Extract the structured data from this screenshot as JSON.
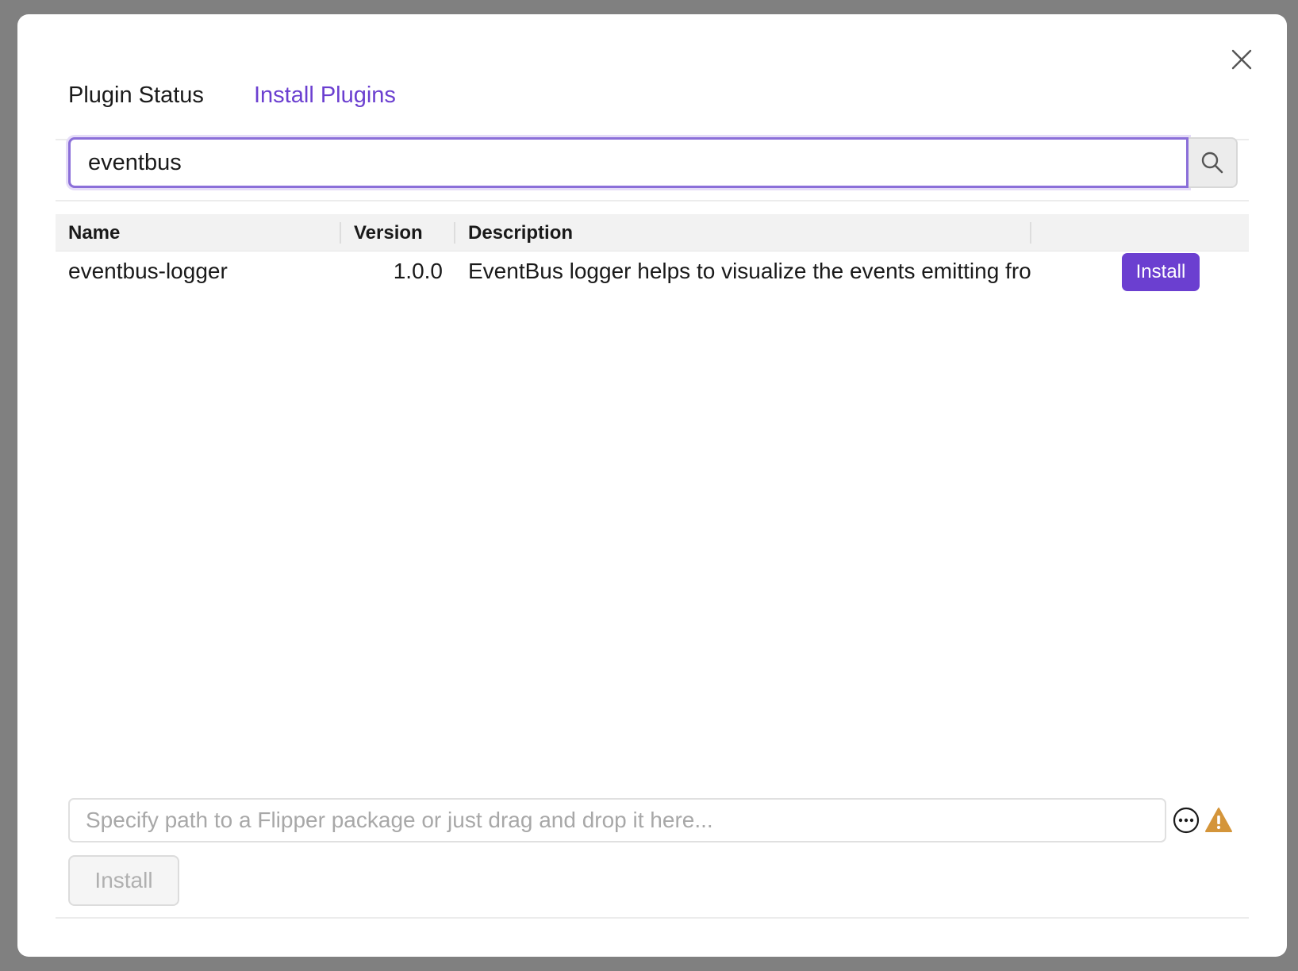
{
  "tabs": [
    {
      "label": "Plugin Status",
      "active": false
    },
    {
      "label": "Install Plugins",
      "active": true
    }
  ],
  "search": {
    "value": "eventbus",
    "icon": "search-icon"
  },
  "table": {
    "columns": [
      "Name",
      "Version",
      "Description"
    ],
    "rows": [
      {
        "name": "eventbus-logger",
        "version": "1.0.0",
        "description": "EventBus logger helps to visualize the events emitting fro",
        "action": "Install"
      }
    ]
  },
  "package_path": {
    "placeholder": "Specify path to a Flipper package or just drag and drop it here...",
    "value": ""
  },
  "install_button": "Install",
  "colors": {
    "accent": "#6b3fd0",
    "warning": "#d4953a"
  },
  "icons": {
    "close": "close-icon",
    "more": "more-icon",
    "warning": "warning-icon"
  }
}
